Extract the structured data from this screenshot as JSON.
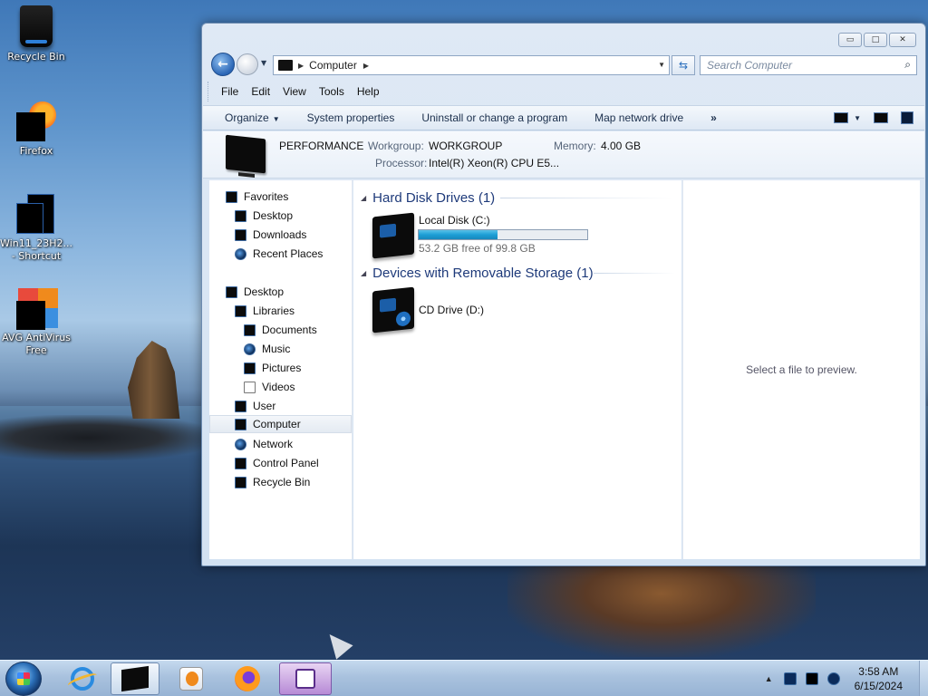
{
  "desktop": {
    "icons": [
      {
        "label": "Recycle Bin",
        "icon": "recycle-bin-icon"
      },
      {
        "label": "Firefox",
        "icon": "firefox-icon"
      },
      {
        "label": "Win11_23H2... - Shortcut",
        "icon": "shortcut-icon"
      },
      {
        "label": "AVG AntiVirus Free",
        "icon": "avg-antivirus-icon"
      }
    ]
  },
  "window": {
    "caption_buttons": {
      "minimize": "▭",
      "maximize": "□",
      "close": "✕"
    },
    "address": {
      "root": "Computer"
    },
    "search": {
      "placeholder": "Search Computer"
    },
    "menu": [
      "File",
      "Edit",
      "View",
      "Tools",
      "Help"
    ],
    "commands": {
      "organize": "Organize",
      "system_properties": "System properties",
      "uninstall": "Uninstall or change a program",
      "map_drive": "Map network drive",
      "more": "»"
    },
    "info": {
      "name": "PERFORMANCE",
      "workgroup_label": "Workgroup:",
      "workgroup": "WORKGROUP",
      "memory_label": "Memory:",
      "memory": "4.00 GB",
      "processor_label": "Processor:",
      "processor": "Intel(R) Xeon(R) CPU E5..."
    },
    "nav_tree": {
      "favorites": "Favorites",
      "desktop_fav": "Desktop",
      "downloads": "Downloads",
      "recent_places": "Recent Places",
      "desktop": "Desktop",
      "libraries": "Libraries",
      "documents": "Documents",
      "music": "Music",
      "pictures": "Pictures",
      "videos": "Videos",
      "user": "User",
      "computer": "Computer",
      "network": "Network",
      "control_panel": "Control Panel",
      "recycle_bin": "Recycle Bin"
    },
    "groups": {
      "hdd": "Hard Disk Drives (1)",
      "removable": "Devices with Removable Storage (1)"
    },
    "drives": {
      "c": {
        "name": "Local Disk (C:)",
        "free": "53.2 GB free of 99.8 GB",
        "used_fraction": 0.467
      },
      "d": {
        "name": "CD Drive (D:)"
      }
    },
    "preview": {
      "text": "Select a file to preview."
    }
  },
  "taskbar": {
    "clock": {
      "time": "3:58 AM",
      "date": "6/15/2024"
    },
    "tray_arrow": "▲"
  }
}
